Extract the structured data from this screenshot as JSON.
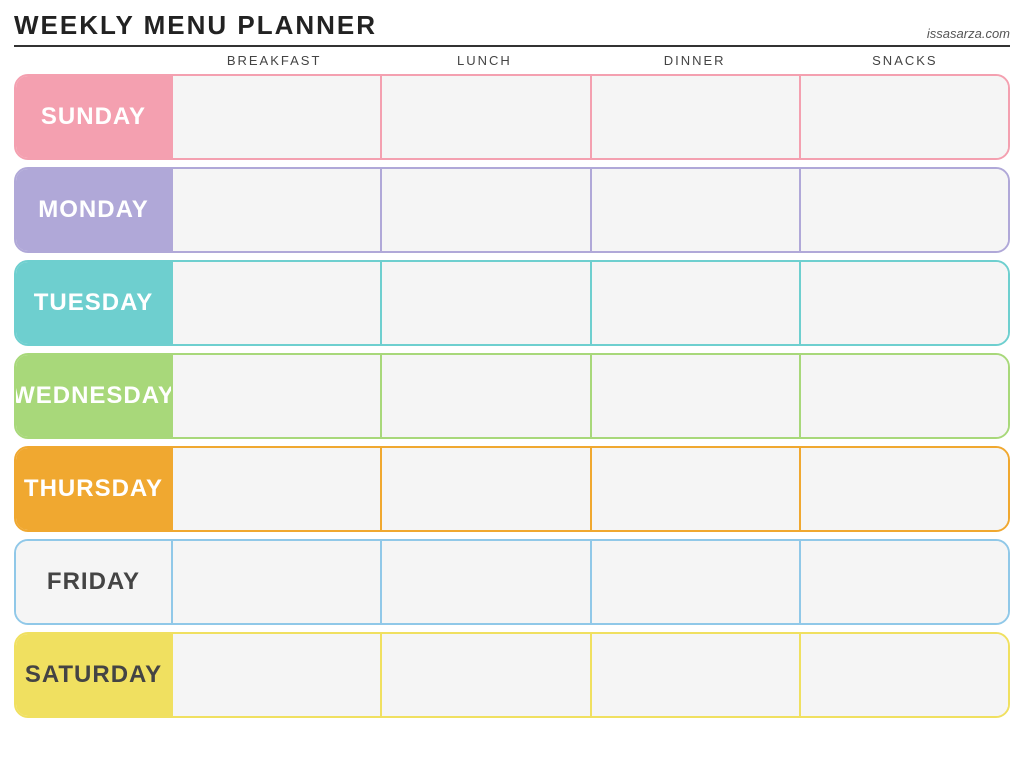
{
  "header": {
    "title": "Weekly Menu Planner",
    "website": "issasarza.com"
  },
  "columns": {
    "spacer": "",
    "breakfast": "Breakfast",
    "lunch": "Lunch",
    "dinner": "Dinner",
    "snacks": "Snacks"
  },
  "days": [
    {
      "id": "sunday",
      "label": "Sunday",
      "class": "sunday"
    },
    {
      "id": "monday",
      "label": "Monday",
      "class": "monday"
    },
    {
      "id": "tuesday",
      "label": "Tuesday",
      "class": "tuesday"
    },
    {
      "id": "wednesday",
      "label": "Wednesday",
      "class": "wednesday"
    },
    {
      "id": "thursday",
      "label": "Thursday",
      "class": "thursday"
    },
    {
      "id": "friday",
      "label": "Friday",
      "class": "friday"
    },
    {
      "id": "saturday",
      "label": "Saturday",
      "class": "saturday"
    }
  ]
}
